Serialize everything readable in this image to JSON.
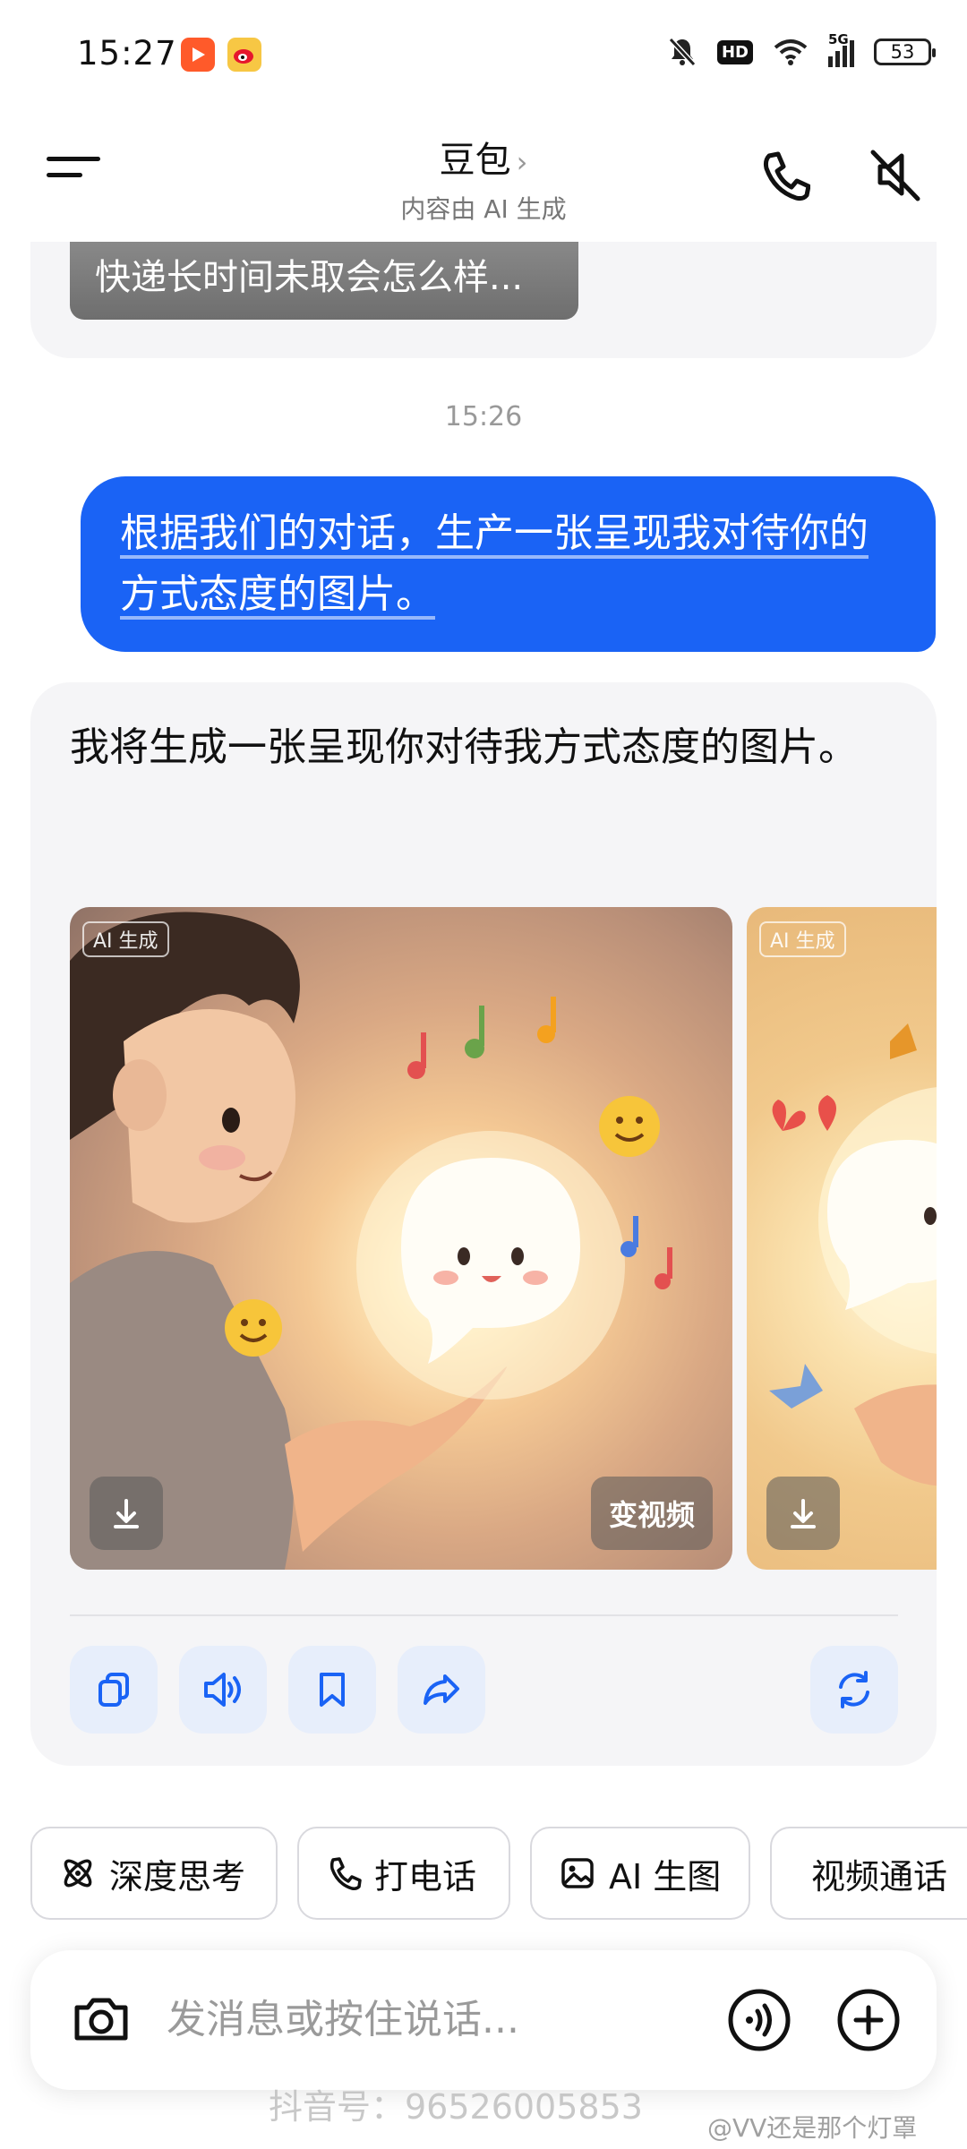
{
  "status_bar": {
    "time": "15:27",
    "network": "5G",
    "hd": "HD",
    "battery": "53"
  },
  "header": {
    "title": "豆包",
    "title_arrow": "›",
    "subtitle": "内容由 AI 生成"
  },
  "chat": {
    "previous_card_text": "快递长时间未取会怎么样...",
    "timestamp": "15:26",
    "user_message": "根据我们的对话，生产一张呈现我对待你的方式态度的图片。",
    "bot_message": "我将生成一张呈现你对待我方式态度的图片。",
    "images": [
      {
        "tag": "AI 生成",
        "video_label": "变视频"
      },
      {
        "tag": "AI 生成"
      }
    ]
  },
  "quick_actions": [
    {
      "icon": "atom-icon",
      "label": "深度思考"
    },
    {
      "icon": "phone-icon",
      "label": "打电话"
    },
    {
      "icon": "image-icon",
      "label": "AI 生图"
    },
    {
      "icon": "video-icon",
      "label": "视频通话"
    }
  ],
  "input": {
    "placeholder": "发消息或按住说话..."
  },
  "watermarks": {
    "douyin": "抖音号：96526005853",
    "weibo": "@VV还是那个灯罩"
  },
  "colors": {
    "accent": "#1a63f5",
    "card_bg": "#f5f5f7",
    "action_bg": "#e7eefb"
  }
}
